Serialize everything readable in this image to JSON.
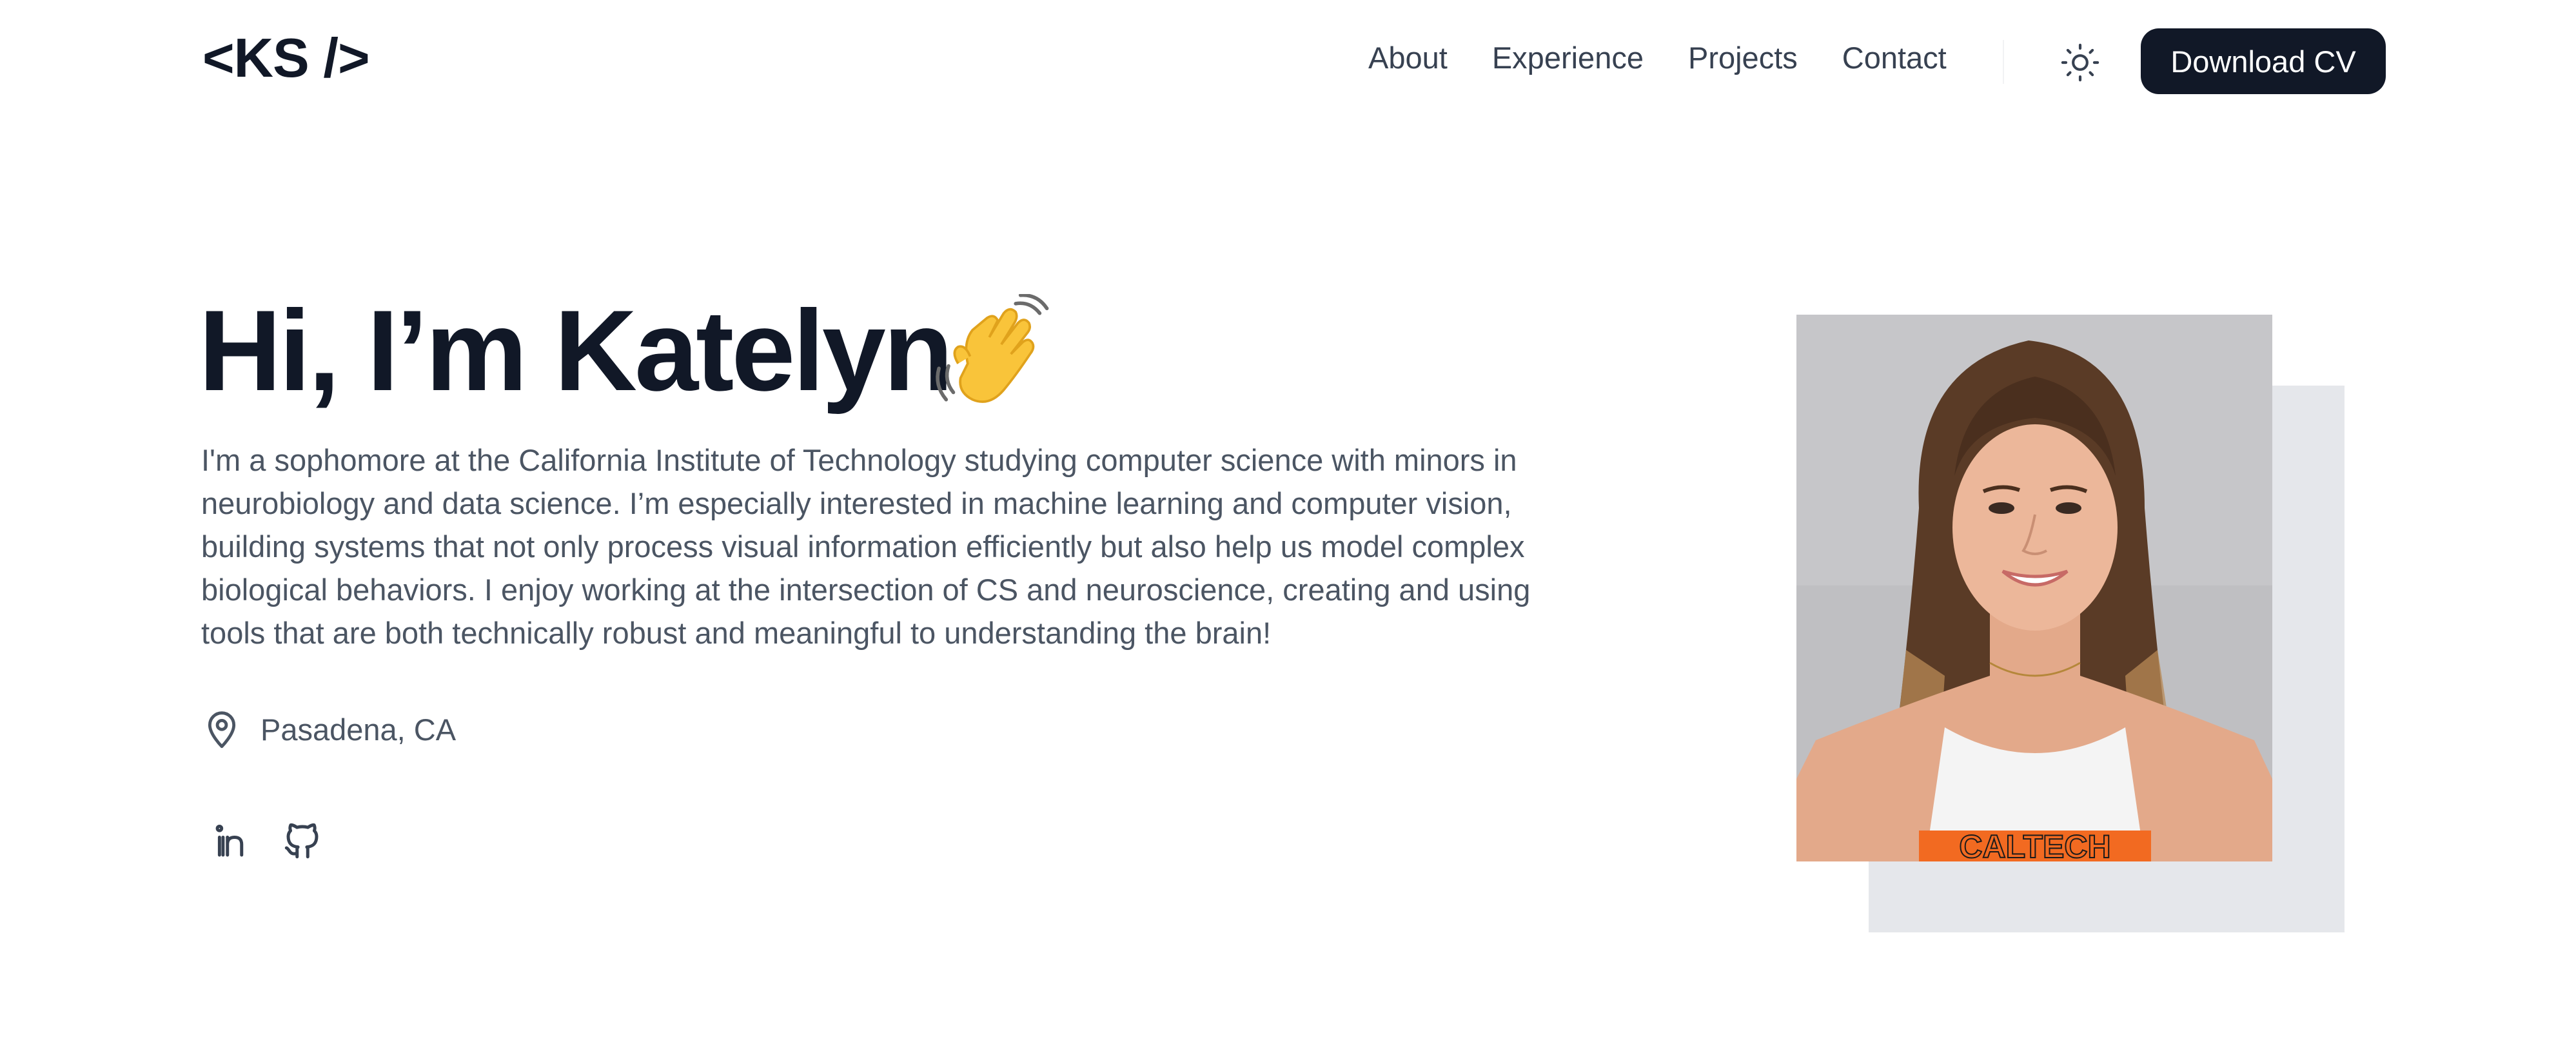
{
  "header": {
    "logo": "<KS />",
    "nav": [
      {
        "label": "About"
      },
      {
        "label": "Experience"
      },
      {
        "label": "Projects"
      },
      {
        "label": "Contact"
      }
    ],
    "theme_toggle_icon": "sun-icon",
    "cv_button_label": "Download CV"
  },
  "hero": {
    "title": "Hi, I’m Katelyn",
    "title_emoji": "waving-hand-icon",
    "bio": "I'm a sophomore at the California Institute of Technology studying computer science with minors in neurobiology and data science. I’m especially interested in machine learning and computer vision, building systems that not only process visual information efficiently but also help us model complex biological behaviors. I enjoy working at the intersection of CS and neuroscience, creating and using tools that are both technically robust and meaningful to understanding the brain!",
    "location_icon": "map-pin-icon",
    "location": "Pasadena, CA",
    "socials": [
      {
        "icon": "linkedin-icon"
      },
      {
        "icon": "github-icon"
      }
    ],
    "photo": {
      "shirt_text": "CALTECH"
    }
  },
  "colors": {
    "text_primary": "#111827",
    "text_secondary": "#4b5563",
    "nav_text": "#374151",
    "button_bg": "#111827",
    "button_text": "#ffffff",
    "photo_shadow": "#e5e7eb",
    "shirt_accent": "#f26a21"
  }
}
